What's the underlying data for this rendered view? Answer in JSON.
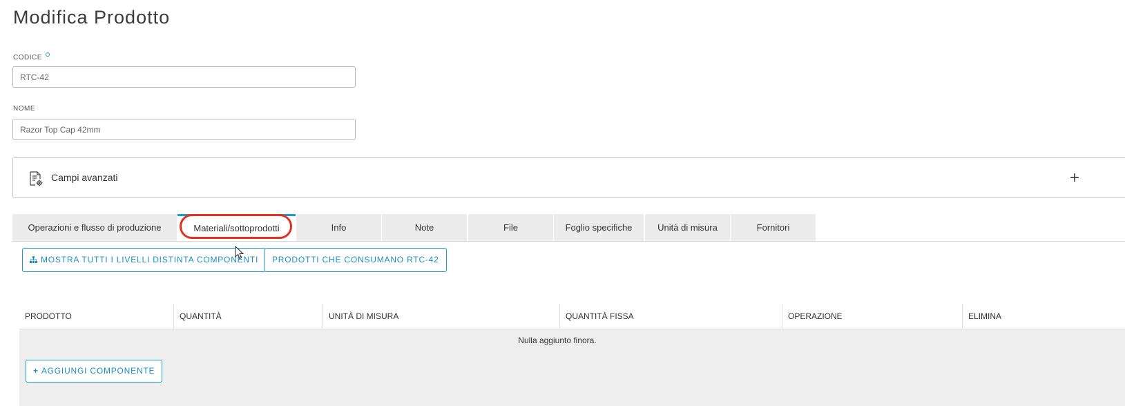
{
  "page": {
    "title": "Modifica Prodotto"
  },
  "form": {
    "code": {
      "label": "CODICE",
      "value": "RTC-42"
    },
    "name": {
      "label": "NOME",
      "value": "Razor Top Cap 42mm"
    }
  },
  "advanced": {
    "label": "Campi avanzati",
    "expand_icon": "+"
  },
  "tabs": [
    {
      "label": "Operazioni e flusso di produzione"
    },
    {
      "label": "Materiali/sottoprodotti"
    },
    {
      "label": "Info"
    },
    {
      "label": "Note"
    },
    {
      "label": "File"
    },
    {
      "label": "Foglio specifiche"
    },
    {
      "label": "Unità di misura"
    },
    {
      "label": "Fornitori"
    }
  ],
  "actions": {
    "show_levels": "MOSTRA TUTTI I LIVELLI DISTINTA COMPONENTI",
    "consumers": "PRODOTTI CHE CONSUMANO RTC-42"
  },
  "table": {
    "columns": [
      "PRODOTTO",
      "QUANTITÀ",
      "UNITÀ DI MISURA",
      "QUANTITÀ FISSA",
      "OPERAZIONE",
      "ELIMINA"
    ],
    "empty_message": "Nulla aggiunto finora.",
    "add_button": "AGGIUNGI COMPONENTE"
  },
  "colors": {
    "accent": "#1a9bd0",
    "highlight": "#e5301e"
  }
}
